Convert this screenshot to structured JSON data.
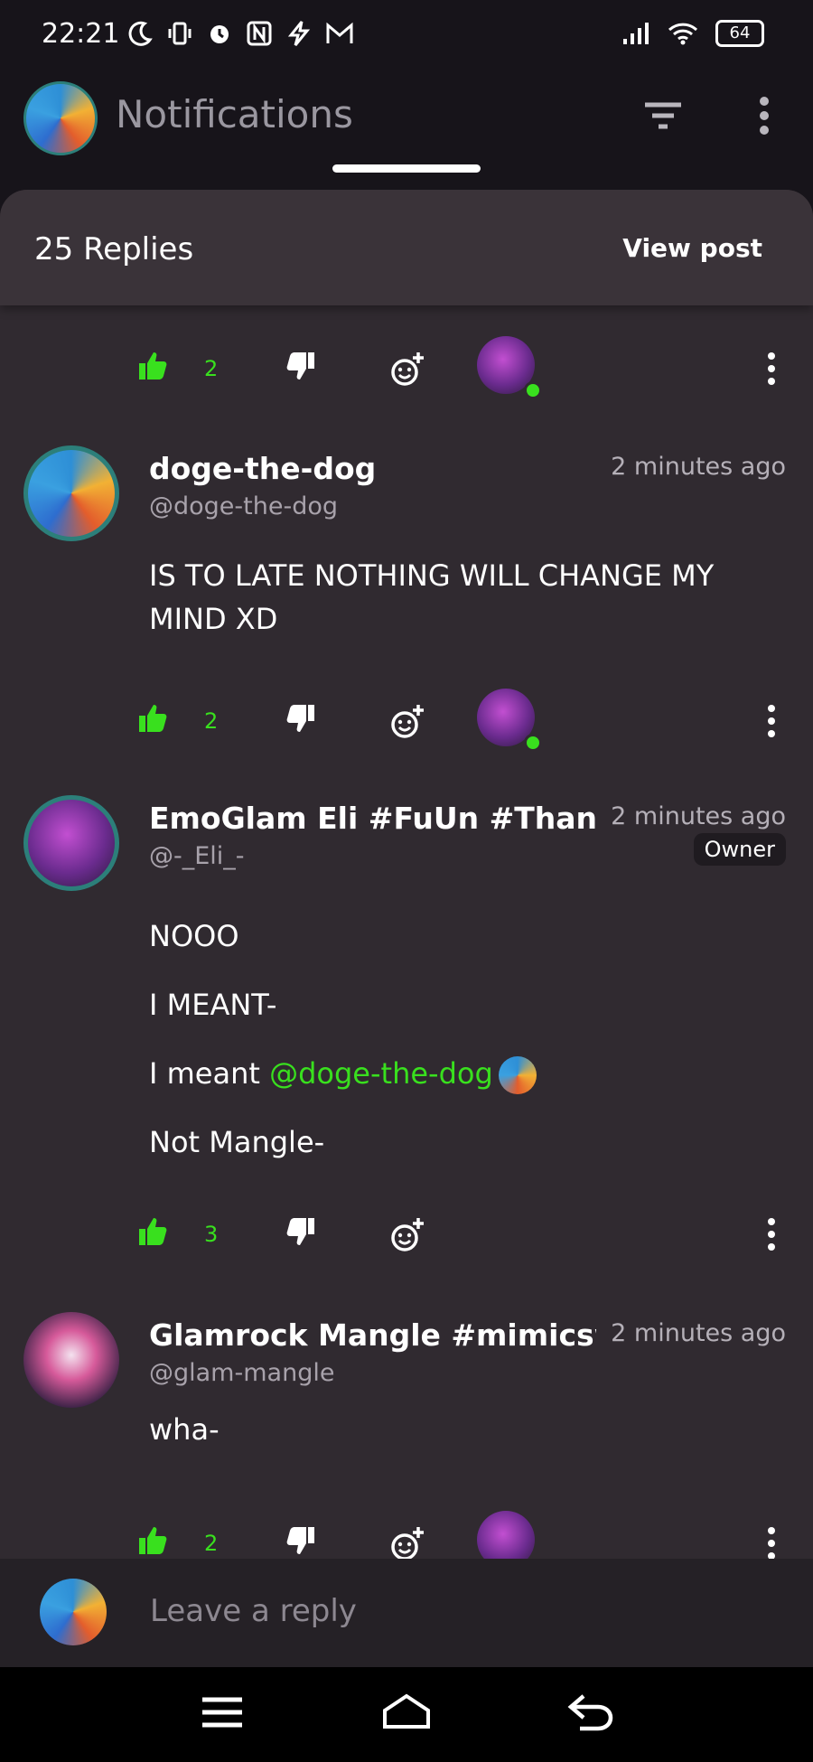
{
  "status_bar": {
    "time": "22:21",
    "battery": "64"
  },
  "app_bar": {
    "title": "Notifications"
  },
  "sheet": {
    "replies_count": "25 Replies",
    "view_post": "View post"
  },
  "colors": {
    "accent_green": "#39e01e",
    "background": "#302a30",
    "header": "#3a3339"
  },
  "rows": [
    {
      "likes": "2"
    },
    {
      "likes": "2"
    },
    {
      "likes": "3"
    },
    {
      "likes": "2"
    }
  ],
  "comments": [
    {
      "name": "doge-the-dog",
      "handle": "@doge-the-dog",
      "time": "2 minutes ago",
      "lines": [
        "IS TO LATE NOTHING WILL CHANGE MY",
        "MIND XD"
      ]
    },
    {
      "name": "EmoGlam Eli #FuUn #ThankYou",
      "handle": "@-_Eli_-",
      "time": "2 minutes ago",
      "badge": "Owner",
      "lines": [
        "NOOO",
        "I MEANT-",
        "I meant ",
        "Not Mangle-"
      ],
      "mention": "@doge-the-dog"
    },
    {
      "name": "Glamrock Mangle #mimicsweek",
      "handle": "@glam-mangle",
      "time": "2 minutes ago",
      "lines": [
        "wha-"
      ]
    }
  ],
  "reply_input": {
    "placeholder": "Leave a reply"
  },
  "icons": [
    "moon-icon",
    "vibrate-icon",
    "alarm-icon",
    "nfc-icon",
    "bolt-icon",
    "gmail-icon",
    "signal-icon",
    "wifi-icon",
    "battery-icon",
    "filter-icon",
    "more-vertical-icon",
    "thumbs-up-icon",
    "thumbs-down-icon",
    "add-reaction-icon",
    "menu-icon",
    "home-icon",
    "back-icon"
  ]
}
